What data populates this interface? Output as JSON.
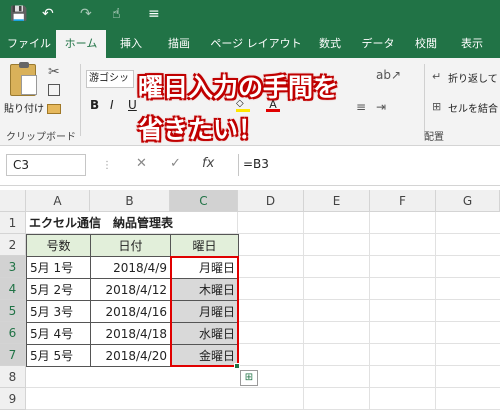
{
  "qat": {
    "save_icon": "💾",
    "undo_icon": "↶",
    "redo_icon": "↷",
    "touch_icon": "☝",
    "customize_icon": "≡"
  },
  "tabs": [
    "ファイル",
    "ホーム",
    "挿入",
    "描画",
    "ページ レイアウト",
    "数式",
    "データ",
    "校閲",
    "表示"
  ],
  "ribbon": {
    "paste_label": "貼り付け",
    "clipboard_label": "クリップボード",
    "font_name": "游ゴシッ",
    "bold": "B",
    "italic": "I",
    "underline": "U",
    "wrap_text": "折り返して全",
    "merge_center": "セルを結合し",
    "alignment_label": "配置"
  },
  "caption": {
    "line1": "曜日入力の手間を",
    "line2": "省きたい！"
  },
  "formula_bar": {
    "name_box": "C3",
    "cancel_icon": "✕",
    "enter_icon": "✓",
    "fx_icon": "fx",
    "formula": "=B3"
  },
  "sheet": {
    "columns": [
      "A",
      "B",
      "C",
      "D",
      "E",
      "F",
      "G"
    ],
    "rows": [
      "1",
      "2",
      "3",
      "4",
      "5",
      "6",
      "7",
      "8",
      "9"
    ],
    "title": "エクセル通信　納品管理表",
    "headers": [
      "号数",
      "日付",
      "曜日"
    ],
    "data": [
      [
        "5月 1号",
        "2018/4/9",
        "月曜日"
      ],
      [
        "5月 2号",
        "2018/4/12",
        "木曜日"
      ],
      [
        "5月 3号",
        "2018/4/16",
        "月曜日"
      ],
      [
        "5月 4号",
        "2018/4/18",
        "水曜日"
      ],
      [
        "5月 5号",
        "2018/4/20",
        "金曜日"
      ]
    ]
  },
  "colors": {
    "excel_green": "#217346",
    "selection_red": "#e00000",
    "header_fill": "#e2efda"
  }
}
